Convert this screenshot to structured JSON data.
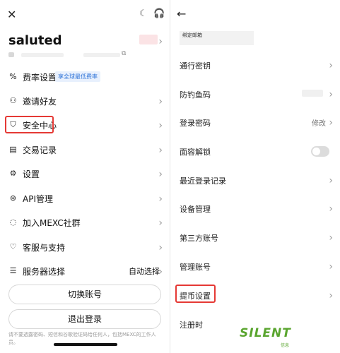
{
  "left": {
    "close_icon": "close-icon",
    "username": "saluted",
    "menu": [
      {
        "id": "fee",
        "label": "费率设置",
        "icon": "percent-icon",
        "badge": "享全球最低费率"
      },
      {
        "id": "invite",
        "label": "邀请好友",
        "icon": "add-person-icon"
      },
      {
        "id": "security",
        "label": "安全中心",
        "icon": "shield-icon"
      },
      {
        "id": "records",
        "label": "交易记录",
        "icon": "document-icon"
      },
      {
        "id": "settings",
        "label": "设置",
        "icon": "gear-icon"
      },
      {
        "id": "api",
        "label": "API管理",
        "icon": "api-icon"
      },
      {
        "id": "community",
        "label": "加入MEXC社群",
        "icon": "chat-icon"
      },
      {
        "id": "support",
        "label": "客服与支持",
        "icon": "heart-icon"
      },
      {
        "id": "server",
        "label": "服务器选择",
        "icon": "sliders-icon",
        "value": "自动选择"
      }
    ],
    "switch_account": "切换账号",
    "logout": "退出登录",
    "disclaimer": "请不要透露密码、短信和谷歌验证码给任何人，包括MEXC的工作人员。"
  },
  "right": {
    "email_header": "绑定邮箱",
    "items": [
      {
        "id": "anti-phishing-pass",
        "label": "通行密钥"
      },
      {
        "id": "anti-phishing-code",
        "label": "防钓鱼码"
      },
      {
        "id": "login-password",
        "label": "登录密码",
        "value": "修改"
      },
      {
        "id": "face-unlock",
        "label": "面容解锁",
        "toggle": false
      },
      {
        "id": "recent-logins",
        "label": "最近登录记录"
      },
      {
        "id": "device-management",
        "label": "设备管理"
      },
      {
        "id": "third-party",
        "label": "第三方账号"
      },
      {
        "id": "manage-account",
        "label": "管理账号"
      },
      {
        "id": "withdraw-settings",
        "label": "提币设置"
      },
      {
        "id": "delete-account",
        "label": "注册时"
      }
    ],
    "watermark": "SILENT",
    "watermark_sub": "信息"
  },
  "colors": {
    "highlight": "#e53935",
    "badge": "#2f74d8",
    "watermark": "#5aa52f"
  }
}
